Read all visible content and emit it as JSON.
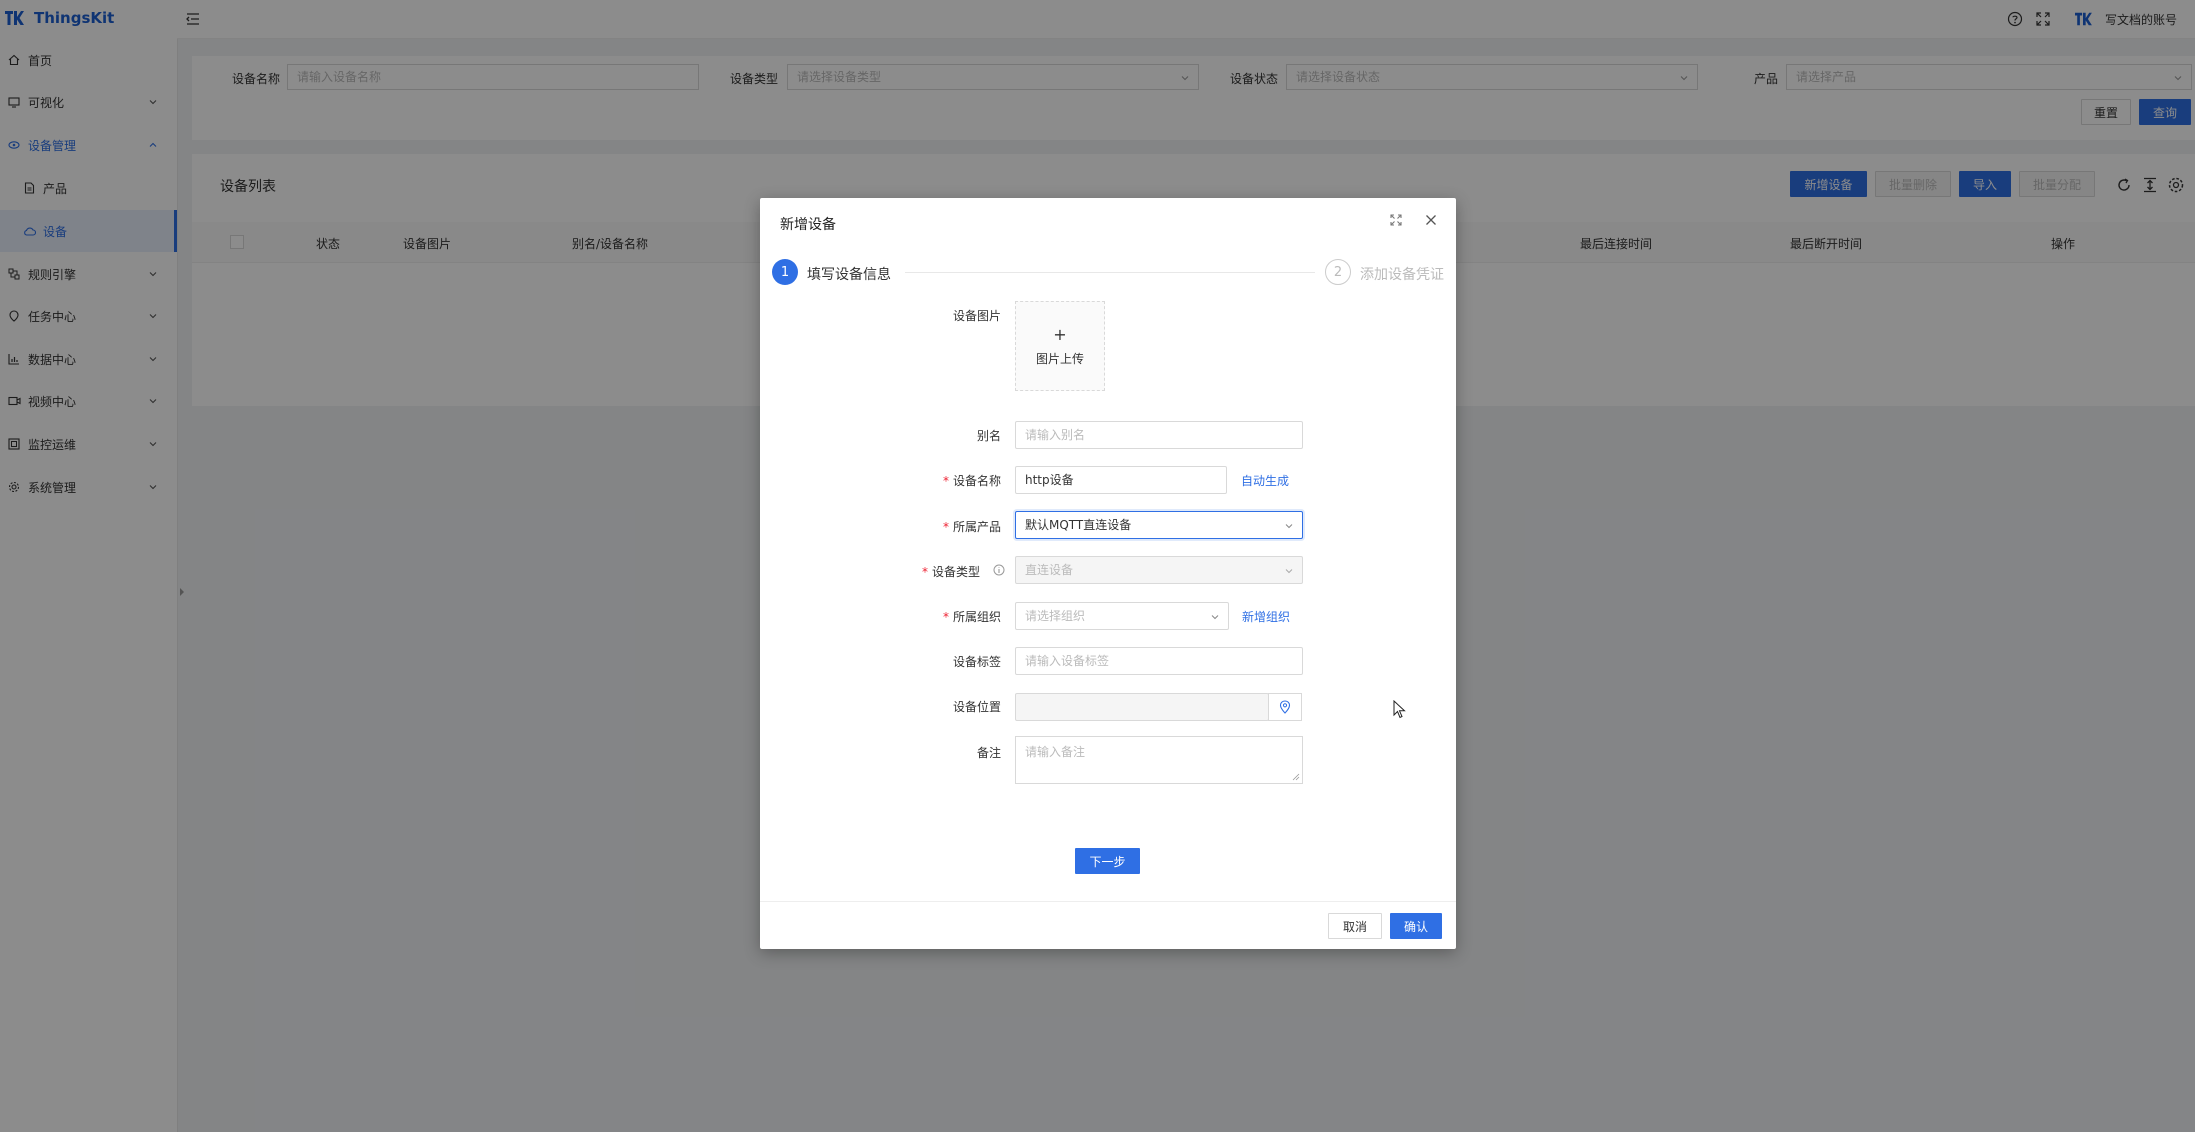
{
  "app": {
    "name": "ThingsKit",
    "user": "写文档的账号"
  },
  "sidebar": {
    "items": [
      {
        "label": "首页",
        "icon": "home-icon"
      },
      {
        "label": "可视化",
        "icon": "visual-icon"
      },
      {
        "label": "设备管理",
        "icon": "device-manage-icon"
      },
      {
        "label": "产品",
        "icon": "file-icon"
      },
      {
        "label": "设备",
        "icon": "cloud-icon"
      },
      {
        "label": "规则引擎",
        "icon": "rule-icon"
      },
      {
        "label": "任务中心",
        "icon": "task-icon"
      },
      {
        "label": "数据中心",
        "icon": "chart-icon"
      },
      {
        "label": "视频中心",
        "icon": "video-icon"
      },
      {
        "label": "监控运维",
        "icon": "monitor-icon"
      },
      {
        "label": "系统管理",
        "icon": "gear-icon"
      }
    ]
  },
  "search": {
    "device_name_label": "设备名称",
    "device_name_placeholder": "请输入设备名称",
    "device_type_label": "设备类型",
    "device_type_placeholder": "请选择设备类型",
    "device_status_label": "设备状态",
    "device_status_placeholder": "请选择设备状态",
    "product_label": "产品",
    "product_placeholder": "请选择产品",
    "reset_label": "重置",
    "query_label": "查询"
  },
  "device_list": {
    "title": "设备列表",
    "add_label": "新增设备",
    "batch_delete_label": "批量删除",
    "import_label": "导入",
    "batch_assign_label": "批量分配",
    "columns": [
      "状态",
      "设备图片",
      "别名/设备名称",
      "最后连接时间",
      "最后断开时间",
      "操作"
    ]
  },
  "modal": {
    "title": "新增设备",
    "steps": [
      {
        "num": "1",
        "label": "填写设备信息"
      },
      {
        "num": "2",
        "label": "添加设备凭证"
      }
    ],
    "image_label": "设备图片",
    "upload_plus": "+",
    "upload_text": "图片上传",
    "alias_label": "别名",
    "alias_placeholder": "请输入别名",
    "name_label": "设备名称",
    "name_value": "http设备",
    "auto_generate": "自动生成",
    "product_label": "所属产品",
    "product_value": "默认MQTT直连设备",
    "type_label": "设备类型",
    "type_value": "直连设备",
    "org_label": "所属组织",
    "org_placeholder": "请选择组织",
    "new_org": "新增组织",
    "tag_label": "设备标签",
    "tag_placeholder": "请输入设备标签",
    "location_label": "设备位置",
    "remark_label": "备注",
    "remark_placeholder": "请输入备注",
    "next_label": "下一步",
    "cancel_label": "取消",
    "confirm_label": "确认",
    "required_mark": "*"
  },
  "colors": {
    "primary": "#2f6fe4",
    "mask": "rgba(0,0,0,0.45)"
  }
}
